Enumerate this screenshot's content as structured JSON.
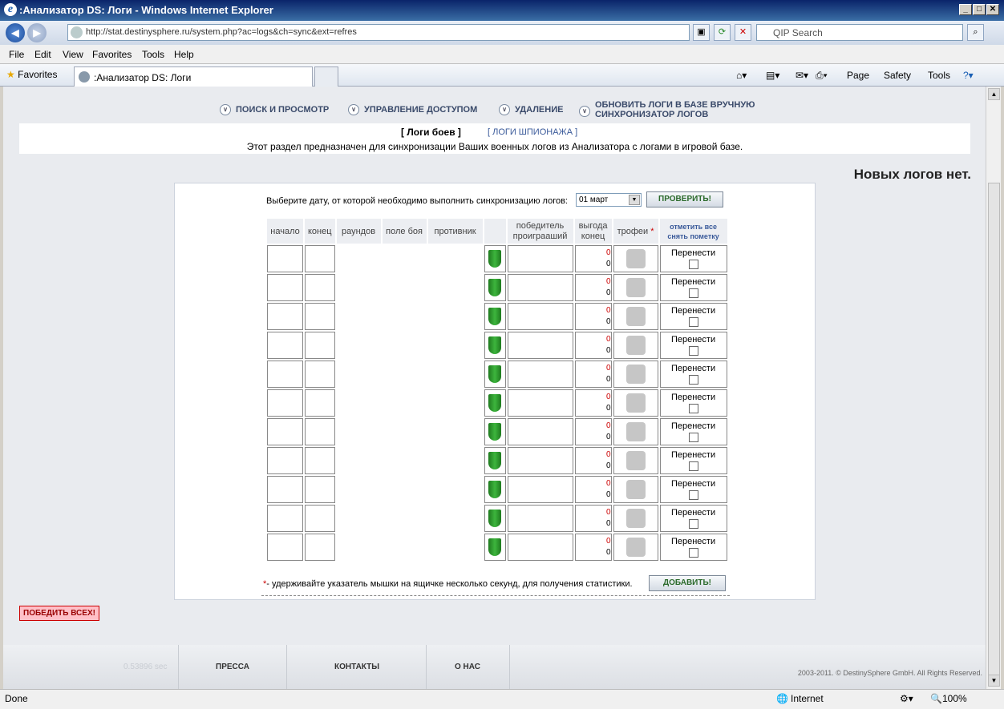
{
  "window": {
    "title": ":Анализатор DS: Логи - Windows Internet Explorer"
  },
  "browser": {
    "url": "http://stat.destinysphere.ru/system.php?ac=logs&ch=sync&ext=refres",
    "search_placeholder": "QIP Search",
    "menu": [
      "File",
      "Edit",
      "View",
      "Favorites",
      "Tools",
      "Help"
    ],
    "favorites_label": "Favorites",
    "tab_title": ":Анализатор DS: Логи",
    "commands": [
      "Page",
      "Safety",
      "Tools"
    ]
  },
  "nav": {
    "items": [
      "ПОИСК И ПРОСМОТР",
      "УПРАВЛЕНИЕ ДОСТУПОМ",
      "УДАЛЕНИЕ"
    ],
    "refresh_line1": "ОБНОВИТЬ ЛОГИ В БАЗЕ ВРУЧНУЮ",
    "refresh_line2": "СИНХРОНИЗАТОР ЛОГОВ"
  },
  "subtabs": {
    "battle": "[ Логи боев ]",
    "spy": "[ ЛОГИ ШПИОНАЖА ]"
  },
  "description": "Этот раздел предназначен для синхронизации Ваших военных логов из Анализатора с логами в игровой базе.",
  "no_new_logs": "Новых логов нет.",
  "form": {
    "date_prompt": "Выберите дату, от которой необходимо выполнить синхронизацию логов:",
    "date_value": "01 март",
    "check_button": "ПРОВЕРИТЬ!",
    "add_button": "ДОБАВИТЬ!",
    "hint_star": "*",
    "hint": "- удерживайте указатель мышки на ящичке несколько секунд, для получения статистики."
  },
  "table": {
    "headers": {
      "start": "начало",
      "end": "конец",
      "rounds": "раундов",
      "field": "поле боя",
      "opponent": "противник",
      "winner": "победитель",
      "loser": "проиграаший",
      "profit": "выгода",
      "profit2": "конец",
      "trophies": "трофеи",
      "trophies_star": "*",
      "mark_all": "отметить все",
      "unmark": "снять пометку"
    },
    "rows": [
      {
        "v1": "0",
        "v2": "0",
        "move": "Перенести"
      },
      {
        "v1": "0",
        "v2": "0",
        "move": "Перенести"
      },
      {
        "v1": "0",
        "v2": "0",
        "move": "Перенести"
      },
      {
        "v1": "0",
        "v2": "0",
        "move": "Перенести"
      },
      {
        "v1": "0",
        "v2": "0",
        "move": "Перенести"
      },
      {
        "v1": "0",
        "v2": "0",
        "move": "Перенести"
      },
      {
        "v1": "0",
        "v2": "0",
        "move": "Перенести"
      },
      {
        "v1": "0",
        "v2": "0",
        "move": "Перенести"
      },
      {
        "v1": "0",
        "v2": "0",
        "move": "Перенести"
      },
      {
        "v1": "0",
        "v2": "0",
        "move": "Перенести"
      },
      {
        "v1": "0",
        "v2": "0",
        "move": "Перенести"
      }
    ]
  },
  "beat_all": "ПОБЕДИТЬ ВСЕХ!",
  "footer": {
    "time": "0.53896 sec",
    "links": [
      "ПРЕССА",
      "КОНТАКТЫ",
      "О НАС"
    ],
    "copyright": "2003-2011. © DestinySphere GmbH. All Rights Reserved."
  },
  "status": {
    "left": "Done",
    "zone": "Internet",
    "zoom": "100%"
  }
}
